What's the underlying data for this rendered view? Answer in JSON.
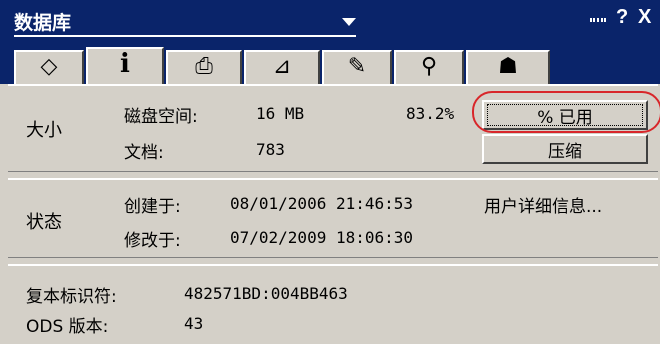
{
  "window": {
    "title": "数据库",
    "controls": {
      "help": "?",
      "close": "X"
    }
  },
  "tabs": [
    {
      "icon": "disk-properties-icon",
      "glyph": "◇"
    },
    {
      "icon": "info-icon",
      "glyph": "i",
      "active": true
    },
    {
      "icon": "printer-icon",
      "glyph": "⎙"
    },
    {
      "icon": "design-icon",
      "glyph": "⊿"
    },
    {
      "icon": "pen-icon",
      "glyph": "✎"
    },
    {
      "icon": "search-icon",
      "glyph": "⚲"
    },
    {
      "icon": "users-icon",
      "glyph": "☗"
    }
  ],
  "size_section": {
    "label": "大小",
    "disk_space_label": "磁盘空间:",
    "disk_space_value": "16 MB",
    "percent_value": "83.2%",
    "documents_label": "文档:",
    "documents_value": "783",
    "percent_used_button": "% 已用",
    "compact_button": "压缩"
  },
  "status_section": {
    "label": "状态",
    "created_label": "创建于:",
    "created_value": "08/01/2006 21:46:53",
    "modified_label": "修改于:",
    "modified_value": "07/02/2009 18:06:30",
    "user_details_button": "用户详细信息..."
  },
  "replica_section": {
    "replica_id_label": "复本标识符:",
    "replica_id_value": "482571BD:004BB463",
    "ods_label": "ODS 版本:",
    "ods_value": "43"
  },
  "colors": {
    "title_bar": "#0a246a",
    "panel": "#d4d0c8",
    "highlight_circle": "#d8262a"
  }
}
